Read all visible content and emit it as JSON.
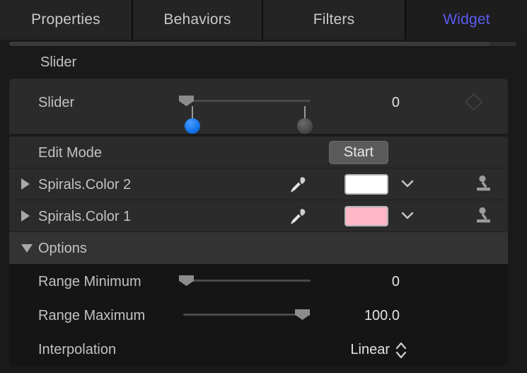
{
  "tabs": [
    {
      "label": "Properties",
      "active": false
    },
    {
      "label": "Behaviors",
      "active": false
    },
    {
      "label": "Filters",
      "active": false
    },
    {
      "label": "Widget",
      "active": true
    }
  ],
  "accent_color": "#5b5bf0",
  "groups": {
    "slider_header": "Slider",
    "options_header": "Options"
  },
  "slider_row": {
    "label": "Slider",
    "value": "0",
    "keyframe_icon": "diamond-keyframe-icon",
    "marker_blue": "blue-range-marker",
    "marker_grey": "grey-range-marker"
  },
  "edit_mode": {
    "label": "Edit Mode",
    "button_label": "Start"
  },
  "color_rows": [
    {
      "label": "Spirals.Color 2",
      "swatch_color": "#ffffff",
      "eyedropper_icon": "eyedropper-icon",
      "chevron_icon": "chevron-down-icon",
      "stamp_icon": "stamp-icon",
      "disclosure": "disclosure-collapsed"
    },
    {
      "label": "Spirals.Color 1",
      "swatch_color": "#ffb6c6",
      "eyedropper_icon": "eyedropper-icon",
      "chevron_icon": "chevron-down-icon",
      "stamp_icon": "stamp-icon",
      "disclosure": "disclosure-collapsed"
    }
  ],
  "options": [
    {
      "label": "Range Minimum",
      "value": "0",
      "kind": "slider",
      "fill": 0.02
    },
    {
      "label": "Range Maximum",
      "value": "100.0",
      "kind": "slider",
      "fill": 0.97
    },
    {
      "label": "Interpolation",
      "value": "Linear",
      "kind": "popup"
    }
  ]
}
